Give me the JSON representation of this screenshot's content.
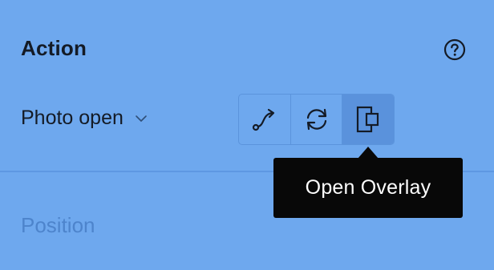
{
  "action_section": {
    "title": "Action",
    "help_icon": "question-circle-icon"
  },
  "trigger": {
    "selected": "Photo open",
    "icon": "chevron-down-icon"
  },
  "action_buttons": [
    {
      "icon": "navigate-connector-icon",
      "active": false
    },
    {
      "icon": "swap-refresh-icon",
      "active": false
    },
    {
      "icon": "open-overlay-icon",
      "active": true
    }
  ],
  "tooltip": {
    "text": "Open Overlay"
  },
  "position_section": {
    "label": "Position"
  },
  "colors": {
    "panel_background": "#6ea8ee",
    "tooltip_background": "#080808",
    "active_button": "#5a92dc",
    "muted_text": "#4d84cc"
  }
}
